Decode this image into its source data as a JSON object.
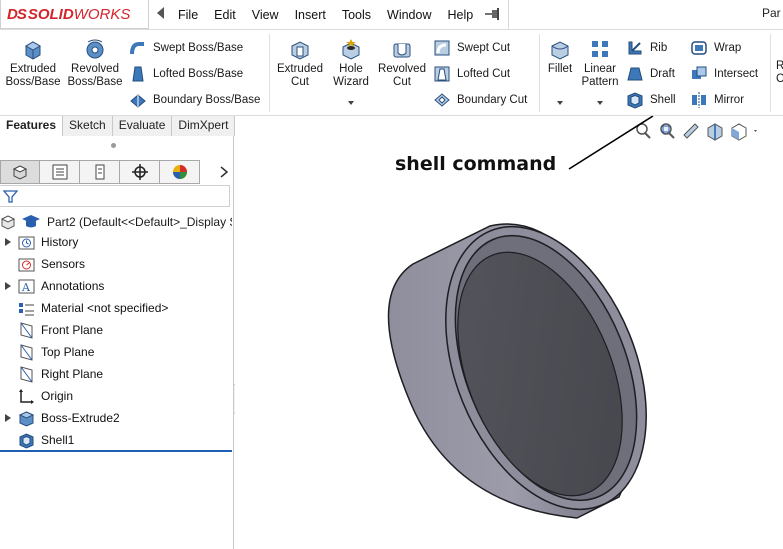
{
  "app": {
    "logo_ds": "DS",
    "logo_solid": "SOLID",
    "logo_works": "WORKS",
    "doc_title": "Par"
  },
  "menu": [
    "File",
    "Edit",
    "View",
    "Insert",
    "Tools",
    "Window",
    "Help"
  ],
  "command_manager": {
    "extruded_boss": "Extruded\nBoss/Base",
    "revolved_boss": "Revolved\nBoss/Base",
    "swept_boss": "Swept Boss/Base",
    "lofted_boss": "Lofted Boss/Base",
    "boundary_boss": "Boundary Boss/Base",
    "extruded_cut": "Extruded\nCut",
    "hole_wizard": "Hole\nWizard",
    "revolved_cut": "Revolved\nCut",
    "swept_cut": "Swept Cut",
    "lofted_cut": "Lofted Cut",
    "boundary_cut": "Boundary Cut",
    "fillet": "Fillet",
    "linear_pattern": "Linear\nPattern",
    "rib": "Rib",
    "draft": "Draft",
    "shell": "Shell",
    "wrap": "Wrap",
    "intersect": "Intersect",
    "mirror": "Mirror",
    "cut_off_label": "R\nC"
  },
  "tabs": [
    "Features",
    "Sketch",
    "Evaluate",
    "DimXpert"
  ],
  "tree": {
    "root": "Part2  (Default<<Default>_Display S",
    "items": [
      {
        "label": "History",
        "icon": "history-folder-icon",
        "expandable": true
      },
      {
        "label": "Sensors",
        "icon": "sensors-icon",
        "expandable": false
      },
      {
        "label": "Annotations",
        "icon": "annotations-icon",
        "expandable": true
      },
      {
        "label": "Material <not specified>",
        "icon": "material-icon",
        "expandable": false
      },
      {
        "label": "Front Plane",
        "icon": "plane-icon",
        "expandable": false
      },
      {
        "label": "Top Plane",
        "icon": "plane-icon",
        "expandable": false
      },
      {
        "label": "Right Plane",
        "icon": "plane-icon",
        "expandable": false
      },
      {
        "label": "Origin",
        "icon": "origin-icon",
        "expandable": false
      },
      {
        "label": "Boss-Extrude2",
        "icon": "boss-extrude-icon",
        "expandable": true
      },
      {
        "label": "Shell1",
        "icon": "shell-feature-icon",
        "expandable": false
      }
    ]
  },
  "annotation": {
    "text": "shell command"
  },
  "colors": {
    "brand_red": "#d5232b",
    "model_body": "#8c8c9c",
    "model_inner": "#4d4d55",
    "selection_blue": "#1f5fb3"
  }
}
